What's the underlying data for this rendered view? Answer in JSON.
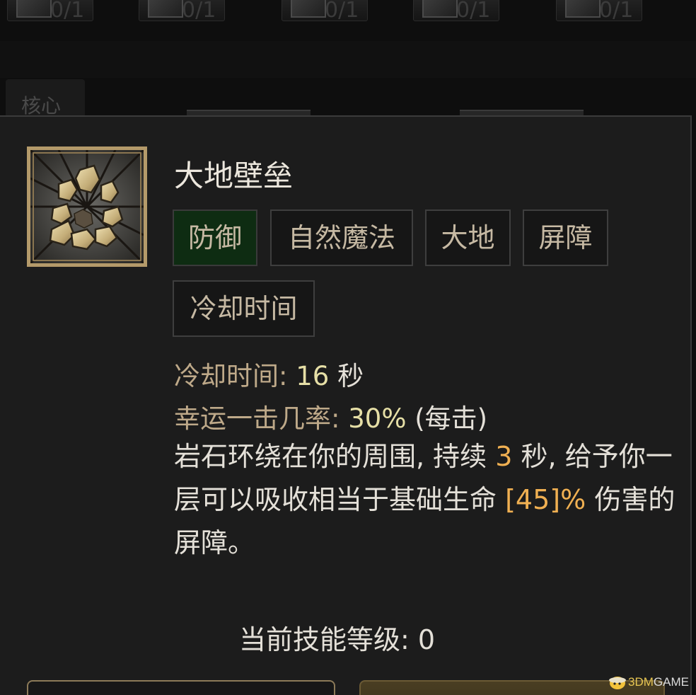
{
  "background": {
    "slot_counts": [
      "0/1",
      "0/1",
      "0/1",
      "0/1",
      "0/1"
    ],
    "section_label": "核心"
  },
  "skill": {
    "name": "大地壁垒",
    "icon": "earth-bulwark-rocks-icon",
    "tags": [
      {
        "label": "防御",
        "active": true
      },
      {
        "label": "自然魔法",
        "active": false
      },
      {
        "label": "大地",
        "active": false
      },
      {
        "label": "屏障",
        "active": false
      },
      {
        "label": "冷却时间",
        "active": false
      }
    ],
    "cooldown": {
      "label": "冷却时间:",
      "value": "16",
      "unit": "秒"
    },
    "lucky_hit": {
      "label": "幸运一击几率:",
      "value": "30%",
      "suffix": "(每击)"
    },
    "description": {
      "part1": "岩石环绕在你的周围, 持续",
      "duration": "3",
      "part2": "秒, 给予你一层可以吸收相当于基础生命",
      "percent_bracket": "[45]",
      "percent_sign": "%",
      "part3": "伤害的屏障。"
    },
    "level_label": "当前技能等级:",
    "level_value": "0"
  },
  "watermark": {
    "left": "3DM",
    "right": "GAME"
  },
  "colors": {
    "label": "#bea989",
    "value": "#e6dfa6",
    "highlight": "#f0b052",
    "active_tag": "#0e2c12",
    "icon_frame": "#b49a6a"
  }
}
